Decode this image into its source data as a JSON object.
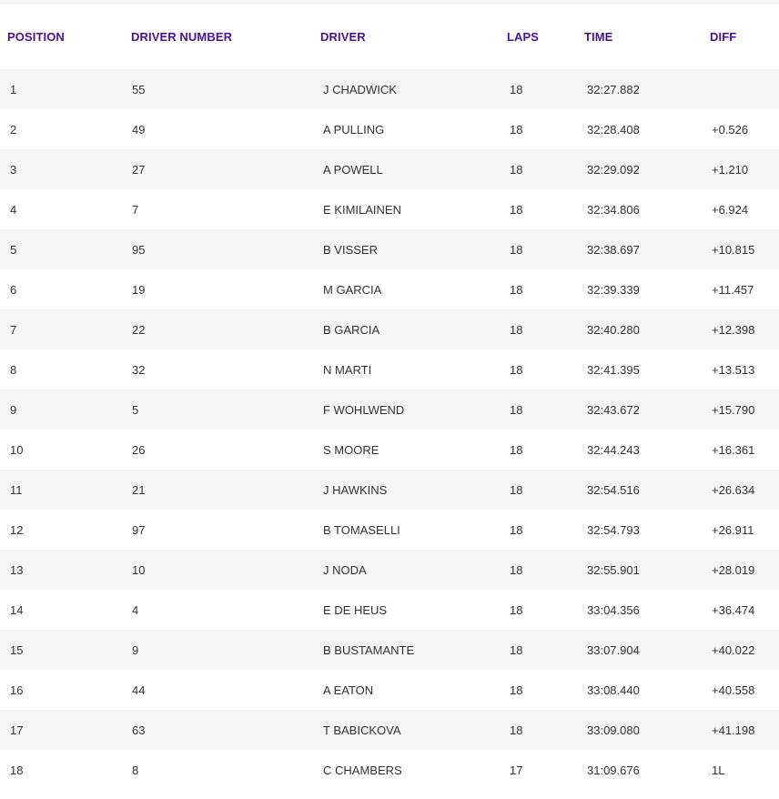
{
  "colors": {
    "header_text": "#4b1295",
    "row_stripe": "#f5f5f5",
    "body_text": "#333333"
  },
  "table": {
    "headers": {
      "position": "POSITION",
      "driver_number": "DRIVER NUMBER",
      "driver": "DRIVER",
      "laps": "LAPS",
      "time": "TIME",
      "diff": "DIFF"
    },
    "rows": [
      {
        "position": "1",
        "driver_number": "55",
        "driver": "J CHADWICK",
        "laps": "18",
        "time": "32:27.882",
        "diff": ""
      },
      {
        "position": "2",
        "driver_number": "49",
        "driver": "A PULLING",
        "laps": "18",
        "time": "32:28.408",
        "diff": "+0.526"
      },
      {
        "position": "3",
        "driver_number": "27",
        "driver": "A POWELL",
        "laps": "18",
        "time": "32:29.092",
        "diff": "+1.210"
      },
      {
        "position": "4",
        "driver_number": "7",
        "driver": "E KIMILAINEN",
        "laps": "18",
        "time": "32:34.806",
        "diff": "+6.924"
      },
      {
        "position": "5",
        "driver_number": "95",
        "driver": "B VISSER",
        "laps": "18",
        "time": "32:38.697",
        "diff": "+10.815"
      },
      {
        "position": "6",
        "driver_number": "19",
        "driver": "M GARCIA",
        "laps": "18",
        "time": "32:39.339",
        "diff": "+11.457"
      },
      {
        "position": "7",
        "driver_number": "22",
        "driver": "B GARCIA",
        "laps": "18",
        "time": "32:40.280",
        "diff": "+12.398"
      },
      {
        "position": "8",
        "driver_number": "32",
        "driver": "N MARTI",
        "laps": "18",
        "time": "32:41.395",
        "diff": "+13.513"
      },
      {
        "position": "9",
        "driver_number": "5",
        "driver": "F WOHLWEND",
        "laps": "18",
        "time": "32:43.672",
        "diff": "+15.790"
      },
      {
        "position": "10",
        "driver_number": "26",
        "driver": "S MOORE",
        "laps": "18",
        "time": "32:44.243",
        "diff": "+16.361"
      },
      {
        "position": "11",
        "driver_number": "21",
        "driver": "J HAWKINS",
        "laps": "18",
        "time": "32:54.516",
        "diff": "+26.634"
      },
      {
        "position": "12",
        "driver_number": "97",
        "driver": "B TOMASELLI",
        "laps": "18",
        "time": "32:54.793",
        "diff": "+26.911"
      },
      {
        "position": "13",
        "driver_number": "10",
        "driver": "J NODA",
        "laps": "18",
        "time": "32:55.901",
        "diff": "+28.019"
      },
      {
        "position": "14",
        "driver_number": "4",
        "driver": "E DE HEUS",
        "laps": "18",
        "time": "33:04.356",
        "diff": "+36.474"
      },
      {
        "position": "15",
        "driver_number": "9",
        "driver": "B BUSTAMANTE",
        "laps": "18",
        "time": "33:07.904",
        "diff": "+40.022"
      },
      {
        "position": "16",
        "driver_number": "44",
        "driver": "A EATON",
        "laps": "18",
        "time": "33:08.440",
        "diff": "+40.558"
      },
      {
        "position": "17",
        "driver_number": "63",
        "driver": "T BABICKOVA",
        "laps": "18",
        "time": "33:09.080",
        "diff": "+41.198"
      },
      {
        "position": "18",
        "driver_number": "8",
        "driver": "C CHAMBERS",
        "laps": "17",
        "time": "31:09.676",
        "diff": "1L"
      }
    ]
  }
}
